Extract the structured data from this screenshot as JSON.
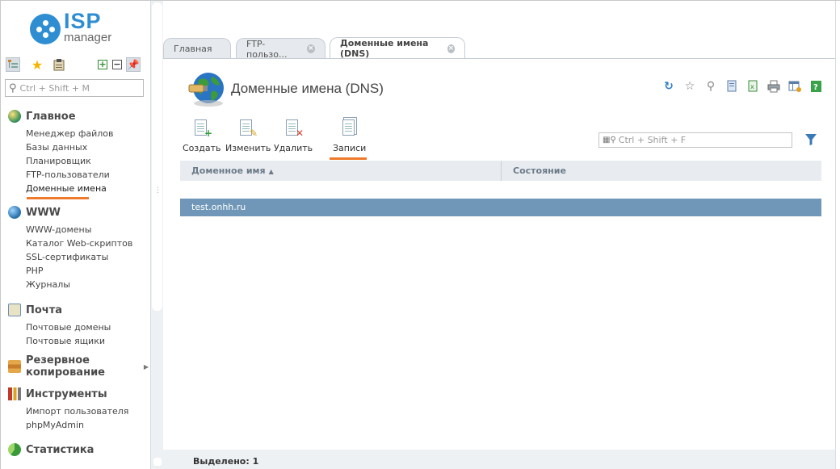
{
  "logo": {
    "brand": "ISP",
    "product": "manager"
  },
  "sidebar": {
    "search_placeholder": "Ctrl + Shift + M",
    "groups": [
      {
        "title": "Главное",
        "icon": "home-globe-icon",
        "items": [
          "Менеджер файлов",
          "Базы данных",
          "Планировщик",
          "FTP-пользователи",
          "Доменные имена"
        ]
      },
      {
        "title": "WWW",
        "icon": "www-globe-icon",
        "items": [
          "WWW-домены",
          "Каталог Web-скриптов",
          "SSL-сертификаты",
          "PHP",
          "Журналы"
        ]
      },
      {
        "title": "Почта",
        "icon": "mail-icon",
        "items": [
          "Почтовые домены",
          "Почтовые ящики"
        ]
      },
      {
        "title": "Резервное копирование",
        "icon": "backup-icon",
        "items": []
      },
      {
        "title": "Инструменты",
        "icon": "tools-icon",
        "items": [
          "Импорт пользователя",
          "phpMyAdmin"
        ]
      },
      {
        "title": "Статистика",
        "icon": "stats-icon",
        "items": []
      }
    ],
    "active_item": "Доменные имена"
  },
  "tabs": [
    {
      "label": "Главная",
      "closable": false
    },
    {
      "label": "FTP-пользо...",
      "closable": true
    },
    {
      "label": "Доменные имена (DNS)",
      "closable": true,
      "active": true
    }
  ],
  "page": {
    "title": "Доменные имена (DNS)",
    "actions": [
      {
        "label": "Создать",
        "icon": "create-icon"
      },
      {
        "label": "Изменить",
        "icon": "edit-icon"
      },
      {
        "label": "Удалить",
        "icon": "delete-icon"
      },
      {
        "label": "Записи",
        "icon": "records-icon",
        "active": true
      }
    ],
    "filter_placeholder": "Ctrl + Shift + F",
    "table": {
      "columns": [
        "Доменное имя",
        "Состояние"
      ],
      "sort_column": "Доменное имя",
      "rows": [
        [
          "test.onhh.ru",
          ""
        ]
      ]
    },
    "status": "Выделено: 1"
  },
  "colors": {
    "accent": "#2f8ed2",
    "selected_row": "#7097b8",
    "underline": "#f07a2c"
  }
}
